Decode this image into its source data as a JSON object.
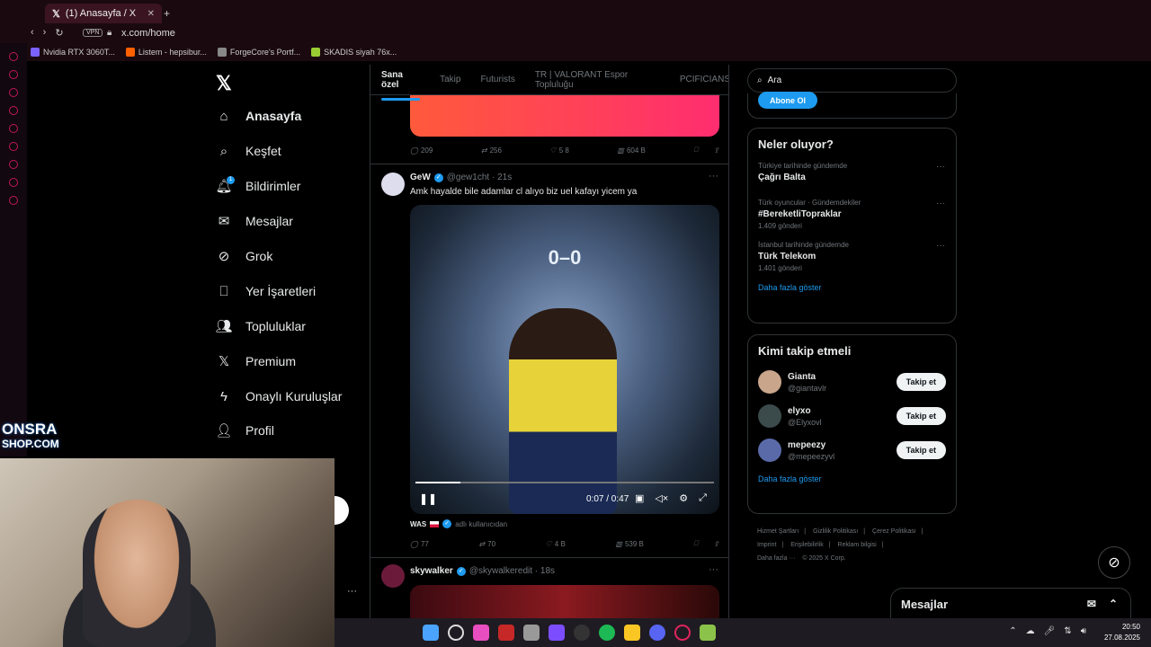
{
  "browser": {
    "tab_title": "(1) Anasayfa / X",
    "url": "x.com/home",
    "vpn_label": "VPN",
    "bookmarks": [
      "Nvidia RTX 3060T...",
      "Listem - hepsibur...",
      "ForgeCore's Portf...",
      "SKADIS siyah 76x..."
    ]
  },
  "nav": {
    "items": [
      {
        "label": "Anasayfa",
        "icon": "home-icon"
      },
      {
        "label": "Keşfet",
        "icon": "search-icon"
      },
      {
        "label": "Bildirimler",
        "icon": "bell-icon",
        "badge": "1"
      },
      {
        "label": "Mesajlar",
        "icon": "mail-icon"
      },
      {
        "label": "Grok",
        "icon": "grok-icon"
      },
      {
        "label": "Yer İşaretleri",
        "icon": "bookmark-icon"
      },
      {
        "label": "Topluluklar",
        "icon": "people-icon"
      },
      {
        "label": "Premium",
        "icon": "x-icon"
      },
      {
        "label": "Onaylı Kuruluşlar",
        "icon": "bolt-icon"
      },
      {
        "label": "Profil",
        "icon": "user-icon"
      }
    ]
  },
  "feed": {
    "tabs": [
      "Sana özel",
      "Takip",
      "Futurists",
      "TR | VALORANT Espor Topluluğu",
      "PCIFICIANS"
    ],
    "post0_actions": {
      "reply": "209",
      "retweet": "256",
      "like": "5 8",
      "views": "604 B"
    },
    "post1": {
      "name": "GeW",
      "handle": "@gew1cht · 21s",
      "text": "Amk hayalde bile adamlar cl alıyo biz uel kafayı yicem ya",
      "video_time": "0:07 / 0:47",
      "score": "0–0",
      "video_progress": 0.15,
      "reply_from": "WAS",
      "reply_user": "adlı kullanıcıdan",
      "actions": {
        "reply": "77",
        "retweet": "70",
        "like": "4 B",
        "views": "539 B"
      }
    },
    "post2": {
      "name": "skywalker",
      "handle": "@skywalkeredit · 18s"
    }
  },
  "right": {
    "search_placeholder": "Ara",
    "subscribe_label": "Abone Ol",
    "trends_title": "Neler oluyor?",
    "trends": [
      {
        "category": "Türkiye tarihinde gündemde",
        "title": "Çağrı Balta",
        "count": ""
      },
      {
        "category": "Türk oyuncular · Gündemdekiler",
        "title": "#BereketliTopraklar",
        "count": "1.409 gönderi"
      },
      {
        "category": "İstanbul tarihinde gündemde",
        "title": "Türk Telekom",
        "count": "1.401 gönderi"
      }
    ],
    "show_more": "Daha fazla göster",
    "who_title": "Kimi takip etmeli",
    "who": [
      {
        "name": "Gianta",
        "handle": "@giantavlr"
      },
      {
        "name": "elyxo",
        "handle": "@Elyxovl"
      },
      {
        "name": "mepeezy",
        "handle": "@mepeezyvl"
      }
    ],
    "follow_label": "Takip et",
    "footer_links": [
      "Hizmet Şartları",
      "Gizlilik Politikası",
      "Çerez Politikası",
      "Imprint",
      "Erişilebilirlik",
      "Reklam bilgisi",
      "Daha fazla ···",
      "© 2025 X Corp."
    ],
    "messages_label": "Mesajlar"
  },
  "overlay": {
    "logo_line1": "ONSRA",
    "logo_line2": "SHOP.COM"
  },
  "taskbar": {
    "time": "20:50",
    "date": "27.08.2025"
  }
}
